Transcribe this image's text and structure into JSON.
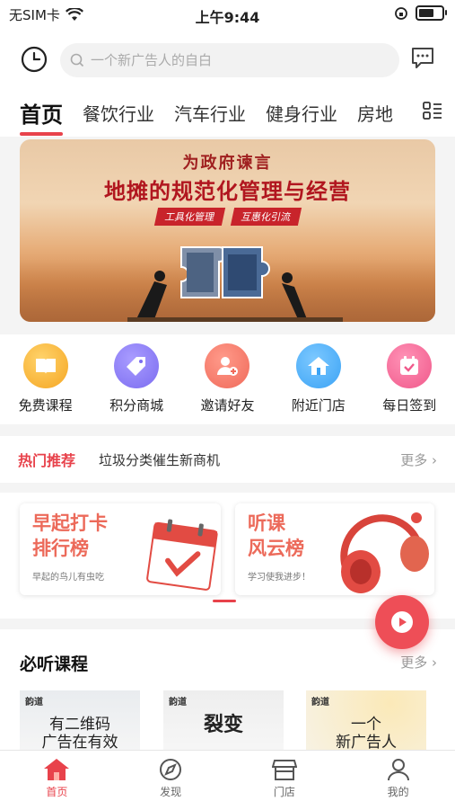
{
  "status_bar": {
    "carrier": "无SIM卡",
    "time": "上午9:44"
  },
  "search": {
    "placeholder": "一个新广告人的自白"
  },
  "tabs": [
    {
      "label": "首页"
    },
    {
      "label": "餐饮行业"
    },
    {
      "label": "汽车行业"
    },
    {
      "label": "健身行业"
    },
    {
      "label": "房地"
    }
  ],
  "banner": {
    "subtitle": "为政府谏言",
    "title": "地摊的规范化管理与经营",
    "tags": [
      "工具化管理",
      "互惠化引流"
    ]
  },
  "quick_links": [
    {
      "label": "免费课程",
      "icon": "book-icon",
      "color": "#f5a623"
    },
    {
      "label": "积分商城",
      "icon": "tag-icon",
      "color": "#7b6cf0"
    },
    {
      "label": "邀请好友",
      "icon": "add-user-icon",
      "color": "#f06a5a"
    },
    {
      "label": "附近门店",
      "icon": "home-icon",
      "color": "#3ba3f5"
    },
    {
      "label": "每日签到",
      "icon": "calendar-check-icon",
      "color": "#f0588a"
    }
  ],
  "hot": {
    "title": "热门推荐",
    "text": "垃圾分类催生新商机",
    "more": "更多"
  },
  "promo_cards": [
    {
      "title_line1": "早起打卡",
      "title_line2": "排行榜",
      "subtitle": "早起的鸟儿有虫吃"
    },
    {
      "title_line1": "听课",
      "title_line2": "风云榜",
      "subtitle": "学习使我进步！"
    }
  ],
  "must_listen": {
    "title": "必听课程",
    "more": "更多",
    "courses": [
      {
        "logo": "韵道",
        "text_line1": "有二维码",
        "text_line2": "广告在有效"
      },
      {
        "logo": "韵道",
        "text_line1": "裂变",
        "text_line2": ""
      },
      {
        "logo": "韵道",
        "text_line1": "一个",
        "text_line2": "新广告人"
      }
    ]
  },
  "bottom_nav": [
    {
      "label": "首页",
      "icon": "home-nav-icon",
      "active": true
    },
    {
      "label": "发现",
      "icon": "compass-icon",
      "active": false
    },
    {
      "label": "门店",
      "icon": "store-icon",
      "active": false
    },
    {
      "label": "我的",
      "icon": "user-icon",
      "active": false
    }
  ],
  "colors": {
    "accent": "#e8424b",
    "fab": "#ee4e57"
  }
}
